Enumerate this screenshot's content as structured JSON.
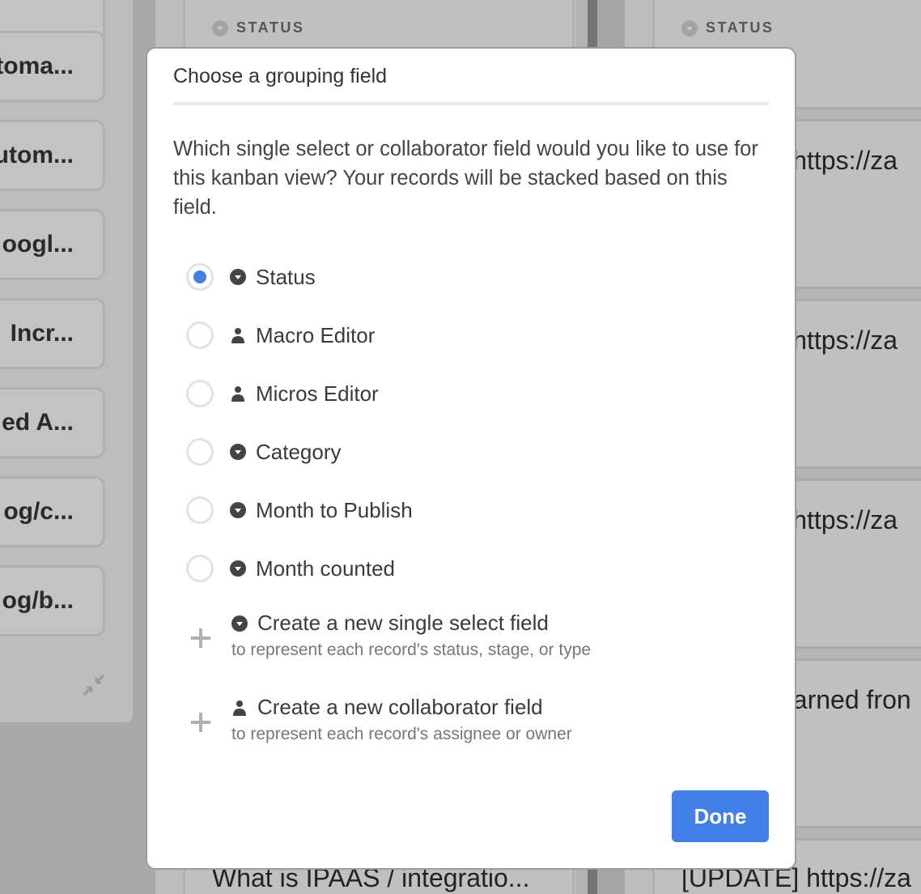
{
  "accent_color": "#4280e8",
  "background": {
    "left_column_cards": [
      {
        "text": "toma..."
      },
      {
        "text": "utom..."
      },
      {
        "text": "oogl..."
      },
      {
        "text": "Incr..."
      },
      {
        "text": "ed A..."
      },
      {
        "text": "og/c..."
      },
      {
        "text": "og/b..."
      }
    ],
    "middle_column": {
      "header": "STATUS",
      "bottom_card_text": "What is IPAAS / integratio..."
    },
    "right_column": {
      "header": "STATUS",
      "cards": [
        {
          "text": "| https://za"
        },
        {
          "text": "| https://za"
        },
        {
          "text": "| https://za"
        },
        {
          "text": "earned fron"
        },
        {
          "text": "[UPDATE] https://za"
        }
      ]
    }
  },
  "modal": {
    "title": "Choose a grouping field",
    "description": "Which single select or collaborator field would you like to use for this kanban view? Your records will be stacked based on this field.",
    "options": [
      {
        "label": "Status",
        "icon": "single-select-icon",
        "selected": true
      },
      {
        "label": "Macro Editor",
        "icon": "collaborator-icon",
        "selected": false
      },
      {
        "label": "Micros Editor",
        "icon": "collaborator-icon",
        "selected": false
      },
      {
        "label": "Category",
        "icon": "single-select-icon",
        "selected": false
      },
      {
        "label": "Month to Publish",
        "icon": "single-select-icon",
        "selected": false
      },
      {
        "label": "Month counted",
        "icon": "single-select-icon",
        "selected": false
      }
    ],
    "create_options": [
      {
        "label": "Create a new single select field",
        "sublabel": "to represent each record's status, stage, or type",
        "icon": "single-select-icon"
      },
      {
        "label": "Create a new collaborator field",
        "sublabel": "to represent each record's assignee or owner",
        "icon": "collaborator-icon"
      }
    ],
    "done_label": "Done"
  }
}
